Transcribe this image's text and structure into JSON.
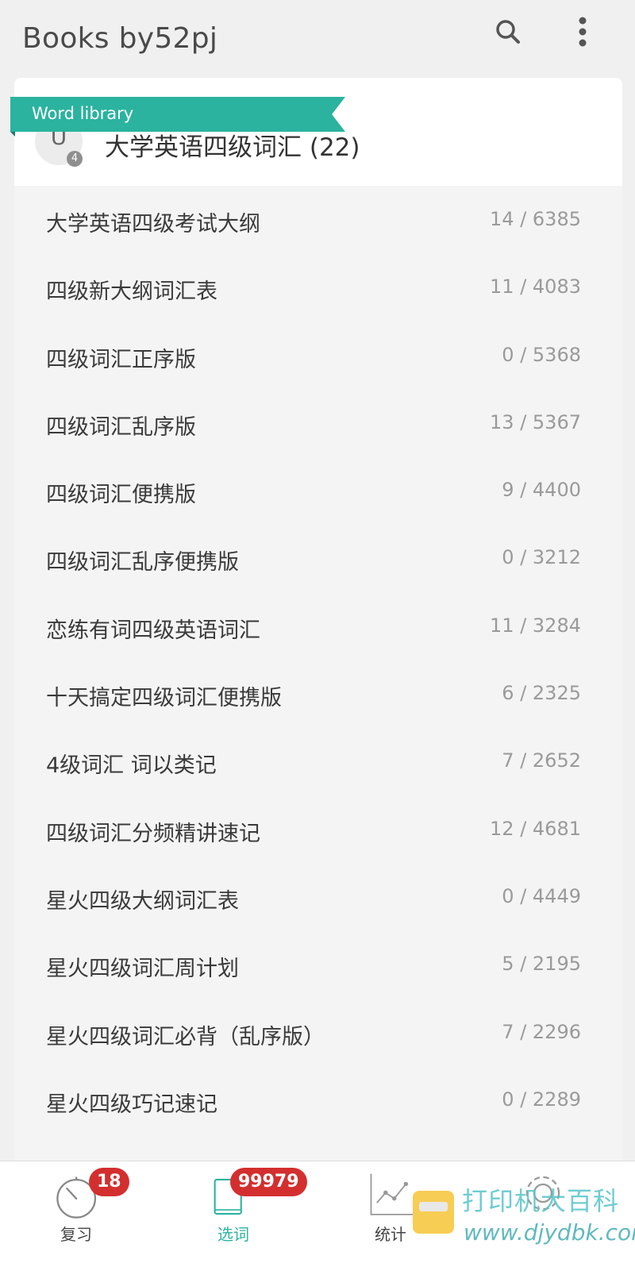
{
  "app_bar": {
    "title": "Books by52pj",
    "search_icon": "search-icon",
    "more_icon": "more-vertical-icon"
  },
  "ribbon": {
    "label": "Word library"
  },
  "group": {
    "icon_letter": "U",
    "icon_badge": "4",
    "title": "大学英语四级词汇 (22)"
  },
  "books": [
    {
      "name": "大学英语四级考试大纲",
      "count": "14 / 6385"
    },
    {
      "name": "四级新大纲词汇表",
      "count": "11 / 4083"
    },
    {
      "name": "四级词汇正序版",
      "count": "0 / 5368"
    },
    {
      "name": "四级词汇乱序版",
      "count": "13 / 5367"
    },
    {
      "name": "四级词汇便携版",
      "count": "9 / 4400"
    },
    {
      "name": "四级词汇乱序便携版",
      "count": "0 / 3212"
    },
    {
      "name": "恋练有词四级英语词汇",
      "count": "11 / 3284"
    },
    {
      "name": "十天搞定四级词汇便携版",
      "count": "6 / 2325"
    },
    {
      "name": "4级词汇  词以类记",
      "count": "7 / 2652"
    },
    {
      "name": "四级词汇分频精讲速记",
      "count": "12 / 4681"
    },
    {
      "name": "星火四级大纲词汇表",
      "count": "0 / 4449"
    },
    {
      "name": "星火四级词汇周计划",
      "count": "5 / 2195"
    },
    {
      "name": "星火四级词汇必背（乱序版）",
      "count": "7 / 2296"
    },
    {
      "name": "星火四级巧记速记",
      "count": "0 / 2289"
    }
  ],
  "bottom_nav": {
    "review": {
      "label": "复习",
      "badge": "18",
      "icon": "timer-icon"
    },
    "select": {
      "label": "选词",
      "badge": "99979",
      "icon": "book-icon"
    },
    "stats": {
      "label": "统计",
      "icon": "chart-icon"
    },
    "settings": {
      "label": "",
      "icon": "gear-icon"
    }
  },
  "watermark": {
    "text": "打印机大百科",
    "url": "www.djydbk.com"
  },
  "colors": {
    "accent": "#2bb39f",
    "badge": "#d32f2f",
    "background": "#f0f0f0"
  }
}
